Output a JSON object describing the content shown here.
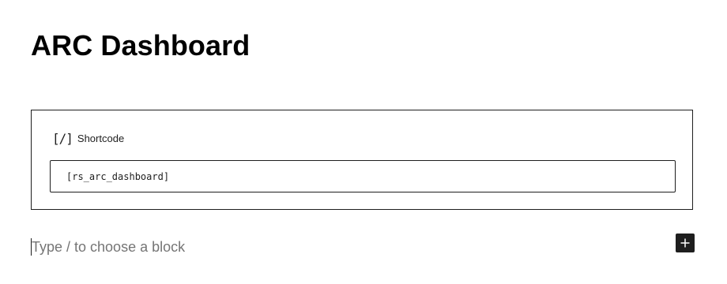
{
  "page": {
    "title": "ARC Dashboard"
  },
  "shortcode_block": {
    "icon": "shortcode-icon",
    "icon_glyph": "[/]",
    "label": "Shortcode",
    "value": "[rs_arc_dashboard]"
  },
  "appender": {
    "placeholder": "Type / to choose a block",
    "add_icon": "plus-icon"
  },
  "colors": {
    "text": "#1e1e1e",
    "placeholder": "#757575",
    "button_bg": "#1e1e1e"
  }
}
